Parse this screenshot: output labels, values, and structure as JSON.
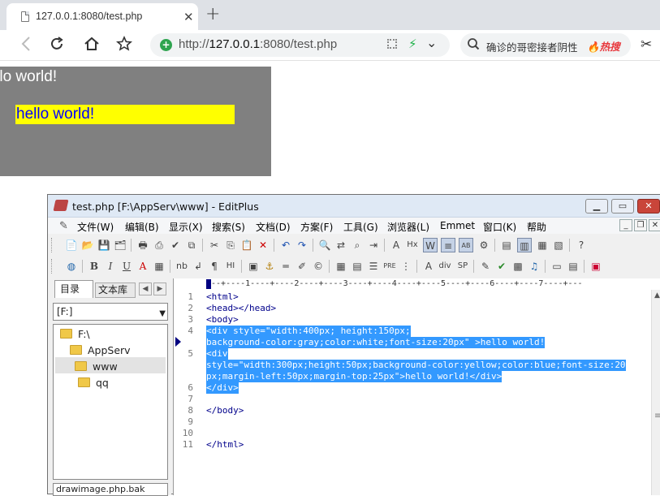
{
  "browser": {
    "tab_title": "127.0.0.1:8080/test.php",
    "tab_close": "✕",
    "new_tab": "+",
    "url_host": "127.0.0.1",
    "url_prefix": "http://",
    "url_suffix": ":8080/test.php",
    "search_text": "确诊的哥密接者阴性",
    "hot_badge": "🔥热搜",
    "icons": [
      "back-icon",
      "reload-icon",
      "home-icon",
      "star-icon",
      "secure-icon",
      "qr-icon",
      "bolt-icon",
      "chevron-down-icon",
      "search-icon",
      "scissors-icon"
    ],
    "colors": {
      "secure": "#2ea44f",
      "hot": "#e8383d"
    }
  },
  "page": {
    "gray_text": "hello world!",
    "yellow_text": "hello world!",
    "colors": {
      "gray": "#808080",
      "yellow": "#ffff00",
      "blue": "#0000ff"
    }
  },
  "editplus": {
    "title": "test.php [F:\\AppServ\\www] - EditPlus",
    "menu": [
      "文件(W)",
      "编辑(B)",
      "显示(X)",
      "搜索(S)",
      "文档(D)",
      "方案(F)",
      "工具(G)",
      "浏览器(L)",
      "Emmet",
      "窗口(K)",
      "帮助"
    ],
    "panel": {
      "tab_dir": "目录",
      "tab_lib": "文本库",
      "drive": "[F:]",
      "tree": [
        "F:\\",
        "AppServ",
        "www",
        "qq"
      ],
      "file_combo": "drawimage.php.bak"
    },
    "ruler": "---+----1----+----2----+----3----+----4----+----5----+----6----+----7----+---",
    "line_numbers": [
      "1",
      "2",
      "3",
      "4",
      "",
      "5",
      "",
      "",
      "6",
      "7",
      "8",
      "9",
      "10",
      "11"
    ],
    "code": {
      "l1": "<html>",
      "l2": "<head></head>",
      "l3": "<body>",
      "l4a": "<div style=\"width:400px; height:150px;",
      "l4b": "background-color:gray;color:white;font-size:20px\" >hello world!",
      "l5a": "<div",
      "l5b": "style=\"width:300px;height:50px;background-color:yellow;color:blue;font-size:20",
      "l5c": "px;margin-left:50px;margin-top:25px\">hello world!</div>",
      "l6": "</div>",
      "l8": "</body>",
      "l11": "</html>"
    },
    "colors": {
      "selection": "#3399ff",
      "code": "#00008b"
    }
  }
}
